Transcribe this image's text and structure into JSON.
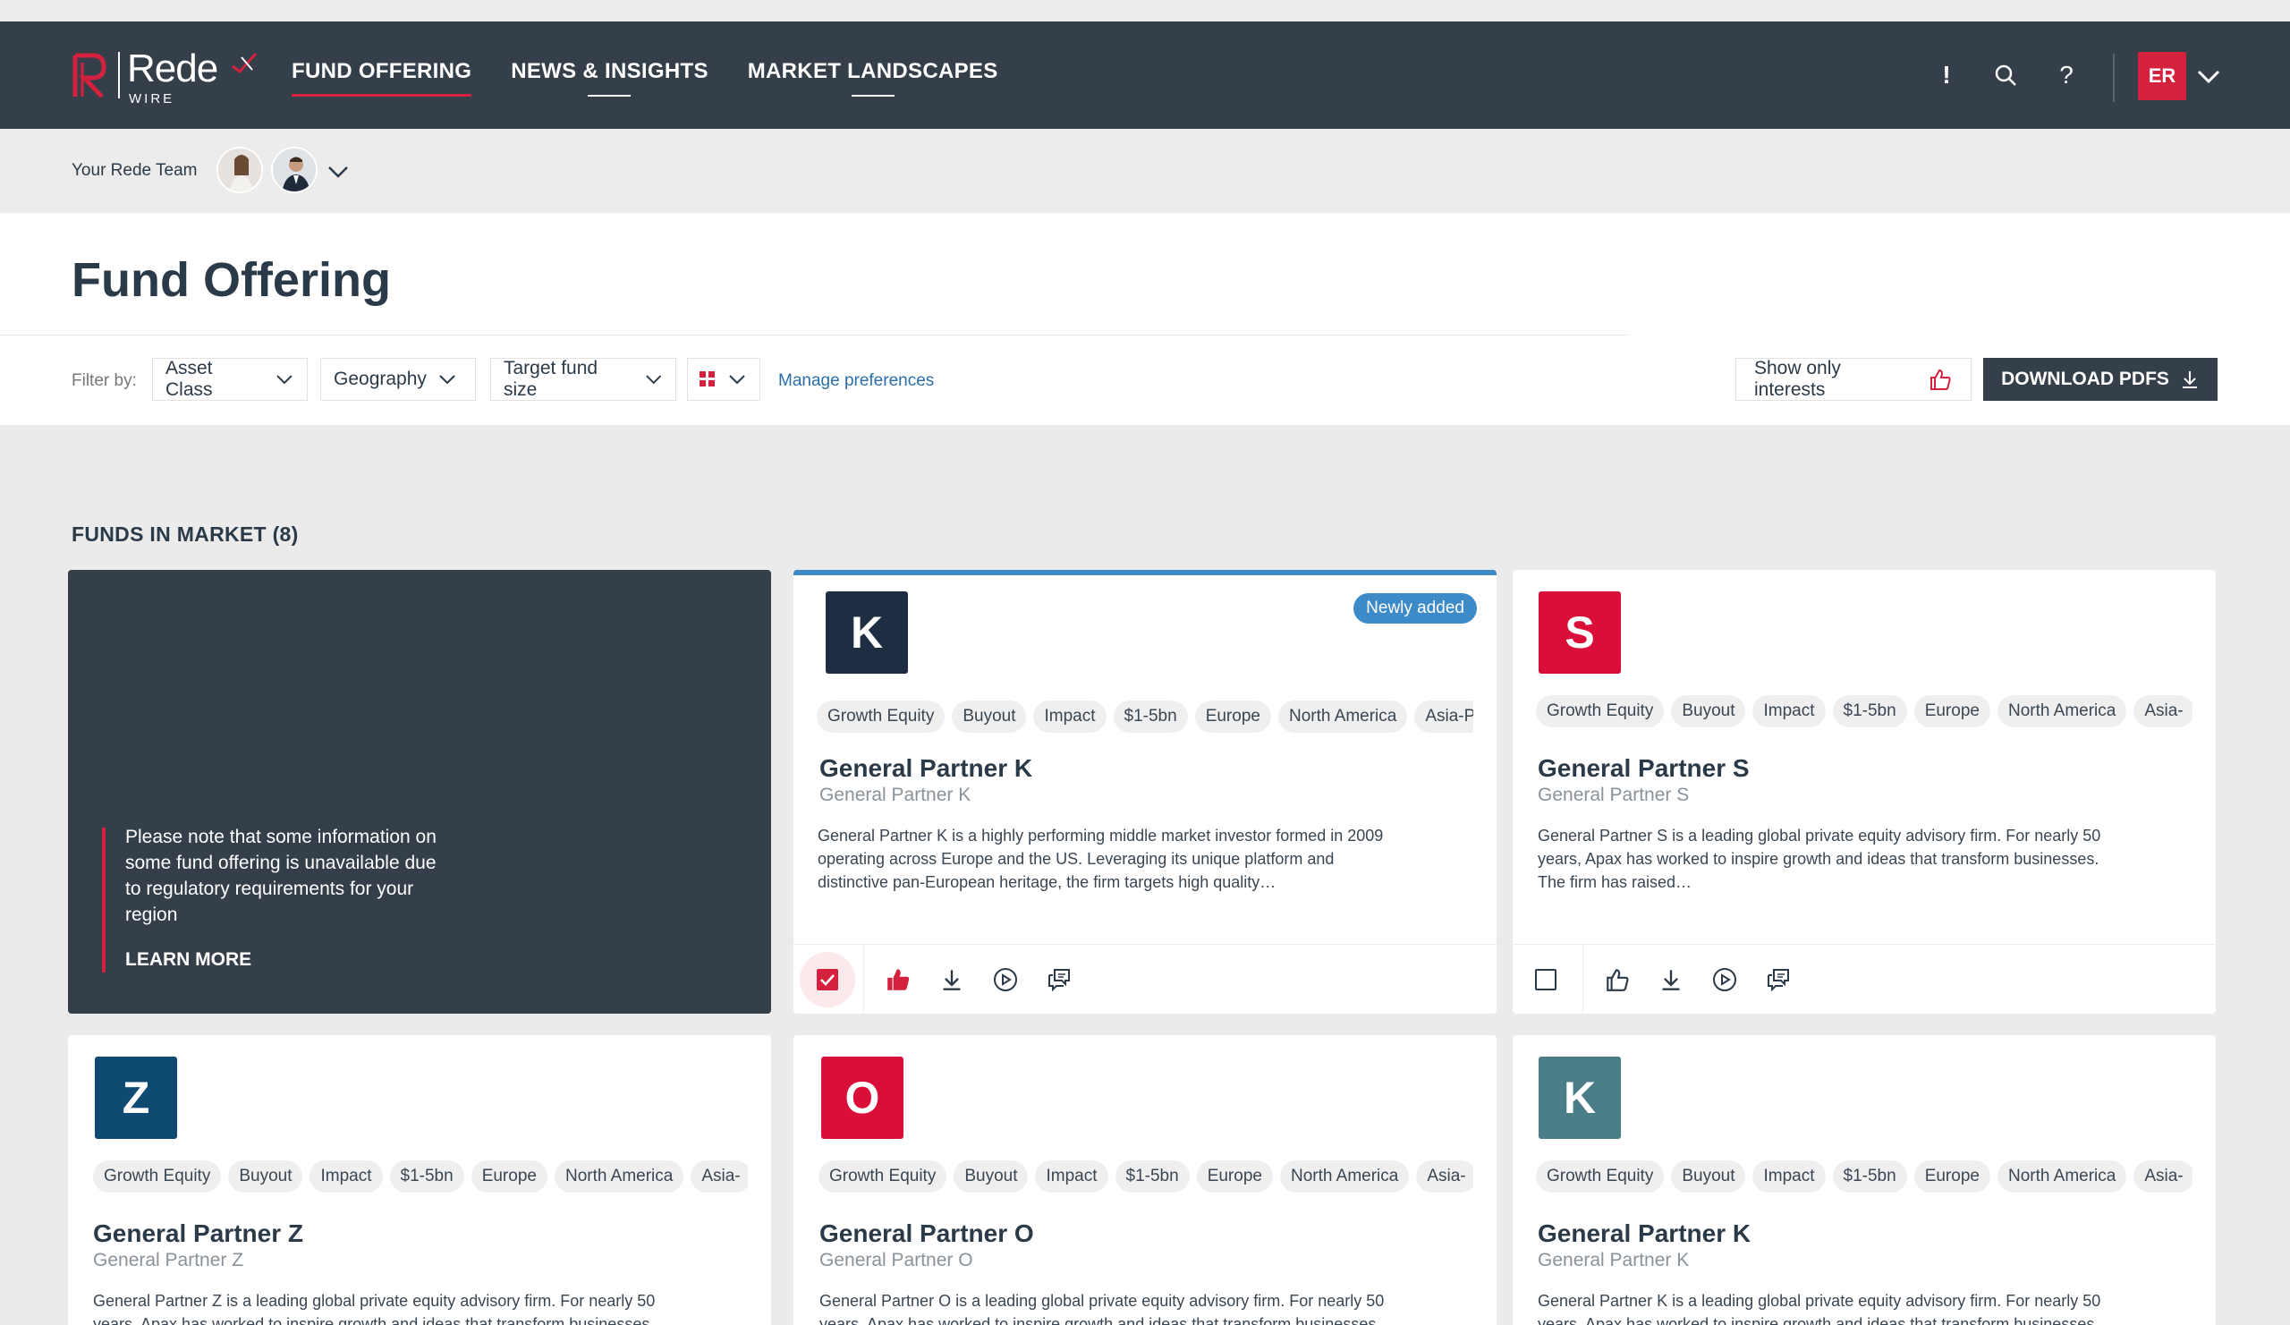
{
  "nav": {
    "brand": "Rede",
    "brand_sub": "WIRE",
    "links": [
      "FUND OFFERING",
      "NEWS & INSIGHTS",
      "MARKET LANDSCAPES"
    ],
    "alert_label": "!",
    "help_label": "?",
    "user_initials": "ER"
  },
  "team": {
    "label": "Your Rede Team"
  },
  "page": {
    "title": "Fund Offering"
  },
  "filters": {
    "label": "Filter by:",
    "asset_class": "Asset Class",
    "geography": "Geography",
    "target_size": "Target fund size",
    "manage": "Manage preferences",
    "show_interests": "Show only interests",
    "download": "DOWNLOAD PDFS"
  },
  "funds": {
    "heading": "FUNDS IN MARKET (8)",
    "notice": "Please note that some information on some fund offering is unavailable due to regulatory requirements for your region",
    "learn_more": "LEARN MORE",
    "badge_new": "Newly added",
    "cards": [
      {
        "letter": "K",
        "color": "#1e2d42",
        "title": "General Partner K",
        "subtitle": "General Partner K",
        "tags": [
          "Growth Equity",
          "Buyout",
          "Impact",
          "$1-5bn",
          "Europe",
          "North America",
          "Asia-P"
        ],
        "desc": "General Partner K is a highly performing middle market investor formed in 2009 operating across Europe and the US. Leveraging its unique platform and distinctive pan-European heritage, the firm targets high quality…",
        "checked": true,
        "liked": true
      },
      {
        "letter": "S",
        "color": "#d90f3a",
        "title": "General Partner S",
        "subtitle": "General Partner S",
        "tags": [
          "Growth Equity",
          "Buyout",
          "Impact",
          "$1-5bn",
          "Europe",
          "North America",
          "Asia-"
        ],
        "desc": "General Partner S is a leading global private equity advisory firm. For nearly 50 years, Apax has worked to inspire growth and ideas that transform businesses. The firm has raised…",
        "checked": false,
        "liked": false
      },
      {
        "letter": "Z",
        "color": "#0f4a73",
        "title": "General Partner Z",
        "subtitle": "General Partner Z",
        "tags": [
          "Growth Equity",
          "Buyout",
          "Impact",
          "$1-5bn",
          "Europe",
          "North America",
          "Asia-"
        ],
        "desc": "General Partner Z is a leading global private equity advisory firm. For nearly 50 years, Apax has worked to inspire growth and ideas that transform businesses."
      },
      {
        "letter": "O",
        "color": "#d90f3a",
        "title": "General Partner O",
        "subtitle": "General Partner O",
        "tags": [
          "Growth Equity",
          "Buyout",
          "Impact",
          "$1-5bn",
          "Europe",
          "North America",
          "Asia-"
        ],
        "desc": "General Partner O is a leading global private equity advisory firm. For nearly 50 years, Apax has worked to inspire growth and ideas that transform businesses."
      },
      {
        "letter": "K",
        "color": "#4b7d86",
        "title": "General Partner K",
        "subtitle": "General Partner K",
        "tags": [
          "Growth Equity",
          "Buyout",
          "Impact",
          "$1-5bn",
          "Europe",
          "North America",
          "Asia-"
        ],
        "desc": "General Partner K is a leading global private equity advisory firm. For nearly 50 years, Apax has worked to inspire growth and ideas that transform businesses."
      }
    ]
  }
}
